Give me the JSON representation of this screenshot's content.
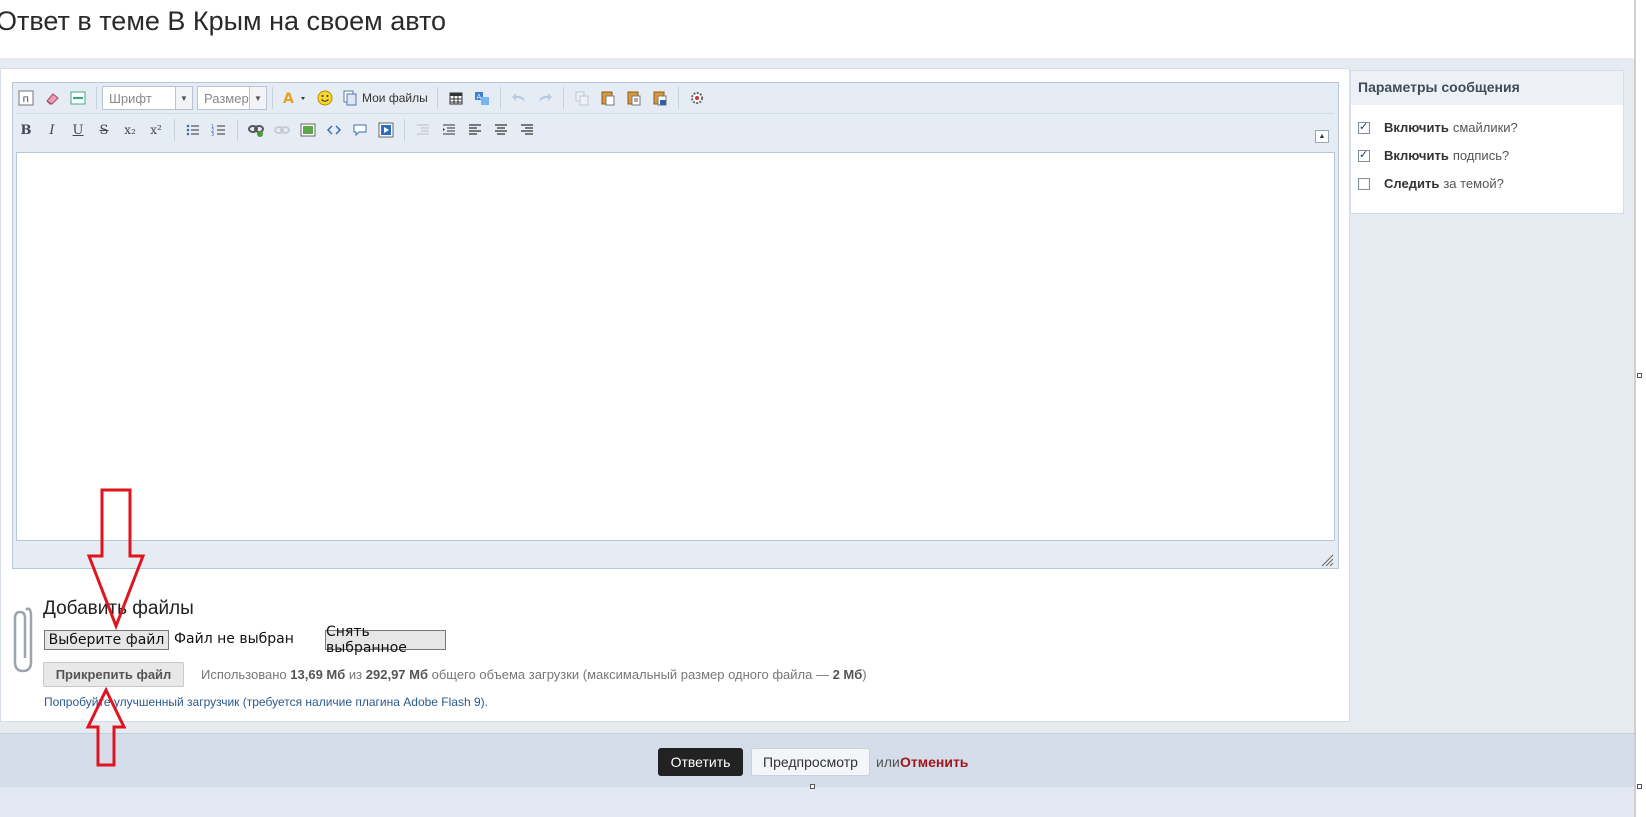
{
  "page": {
    "title": "Ответ в теме В Крым на своем авто"
  },
  "toolbar": {
    "font_select": "Шрифт",
    "size_select": "Размер",
    "my_files": "Мои файлы",
    "bold": "B",
    "italic": "I",
    "underline": "U",
    "strike": "S",
    "subscript": "x₂",
    "superscript": "x²"
  },
  "sidebar": {
    "title": "Параметры сообщения",
    "options": [
      {
        "bold": "Включить",
        "rest": "смайлики?",
        "checked": true
      },
      {
        "bold": "Включить",
        "rest": "подпись?",
        "checked": true
      },
      {
        "bold": "Следить",
        "rest": "за темой?",
        "checked": false
      }
    ]
  },
  "attachments": {
    "heading": "Добавить файлы",
    "choose_file": "Выберите файл",
    "no_file": "Файл не выбран",
    "clear_selected": "Снять выбранное",
    "attach_button": "Прикрепить файл",
    "usage_prefix": "Использовано",
    "used": "13,69 Мб",
    "usage_of": "из",
    "total": "292,97 Мб",
    "usage_suffix": "общего объема загрузки (максимальный размер одного файла —",
    "max_file": "2 Мб",
    "usage_close": ")",
    "flash_link": "Попробуйте улучшенный загрузчик (требуется наличие плагина Adobe Flash 9)."
  },
  "actions": {
    "reply": "Ответить",
    "preview": "Предпросмотр",
    "or": "или",
    "cancel": "Отменить"
  },
  "colors": {
    "annotation_arrow": "#e0141e",
    "cancel_link": "#a1161d",
    "reply_button": "#222222"
  }
}
